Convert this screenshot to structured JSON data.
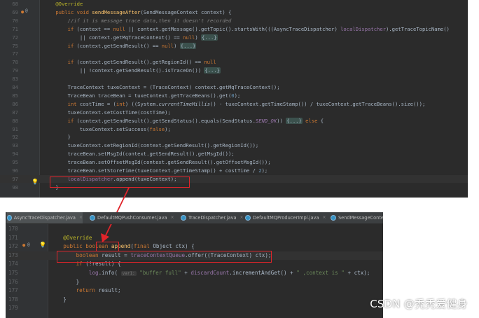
{
  "top_editor": {
    "lines": [
      {
        "n": "68",
        "html": "    <span class=\"an\">@Override</span>"
      },
      {
        "n": "69",
        "html": "    <span class=\"kw\">public void</span> <span class=\"fn\">sendMessageAfter</span>(SendMessageContext context) {"
      },
      {
        "n": "70",
        "html": "        <span class=\"cm\">//if it is message trace data,then it doesn't recorded</span>"
      },
      {
        "n": "71",
        "html": "        <span class=\"kw\">if</span> (context == <span class=\"kw\">null</span> || context.getMessage().getTopic().startsWith(((AsyncTraceDispatcher) <span class=\"fd\">localDispatcher</span>).getTraceTopicName()"
      },
      {
        "n": "72",
        "html": "            || context.getMqTraceContext() == <span class=\"kw\">null</span>) <span class=\"fold\">{...}</span>"
      },
      {
        "n": "75",
        "html": "        <span class=\"kw\">if</span> (context.getSendResult() == <span class=\"kw\">null</span>) <span class=\"fold\">{...}</span>"
      },
      {
        "n": "77",
        "html": ""
      },
      {
        "n": "78",
        "html": "        <span class=\"kw\">if</span> (context.getSendResult().getRegionId() == <span class=\"kw\">null</span>"
      },
      {
        "n": "79",
        "html": "            || !context.getSendResult().isTraceOn()) <span class=\"fold\">{...}</span>"
      },
      {
        "n": "83",
        "html": ""
      },
      {
        "n": "84",
        "html": "        TraceContext tuxeContext = (TraceContext) context.getMqTraceContext();"
      },
      {
        "n": "85",
        "html": "        TraceBean traceBean = tuxeContext.getTraceBeans().get(<span class=\"num\">0</span>);"
      },
      {
        "n": "86",
        "html": "        <span class=\"kw\">int</span> costTime = (<span class=\"kw\">int</span>) ((System.<span class=\"it\">currentTimeMillis</span>() - tuxeContext.getTimeStamp()) / tuxeContext.getTraceBeans().size());"
      },
      {
        "n": "87",
        "html": "        tuxeContext.setCostTime(costTime);"
      },
      {
        "n": "88",
        "html": "        <span class=\"kw\">if</span> (context.getSendResult().getSendStatus().equals(SendStatus.<span class=\"st-fd\">SEND_OK</span>)) <span class=\"fold\">{...}</span> <span class=\"kw\">else</span> {"
      },
      {
        "n": "91",
        "html": "            tuxeContext.setSuccess(<span class=\"kw\">false</span>);"
      },
      {
        "n": "92",
        "html": "        }"
      },
      {
        "n": "93",
        "html": "        tuxeContext.setRegionId(context.getSendResult().getRegionId());"
      },
      {
        "n": "94",
        "html": "        traceBean.setMsgId(context.getSendResult().getMsgId());"
      },
      {
        "n": "95",
        "html": "        traceBean.setOffsetMsgId(context.getSendResult().getOffsetMsgId());"
      },
      {
        "n": "96",
        "html": "        traceBean.setStoreTime(tuxeContext.getTimeStamp() + costTime / <span class=\"num\">2</span>);"
      },
      {
        "n": "97",
        "html": "        <span class=\"fd\">localDispatcher</span>.append(tuxeContext);"
      },
      {
        "n": "98",
        "html": "    }"
      }
    ]
  },
  "tabs": [
    {
      "label": "AsyncTraceDispatcher.java",
      "active": true
    },
    {
      "label": "DefaultMQPushConsumer.java",
      "active": false
    },
    {
      "label": "TraceDispatcher.java",
      "active": false
    },
    {
      "label": "DefaultMQProducerImpl.java",
      "active": false
    },
    {
      "label": "SendMessageContex",
      "active": false
    }
  ],
  "bottom_editor": {
    "lines": [
      {
        "n": "170",
        "html": ""
      },
      {
        "n": "171",
        "html": "    <span class=\"an\">@Override</span>"
      },
      {
        "n": "172",
        "html": "    <span class=\"kw\">public boolean</span> <span class=\"fn\">append</span>(<span class=\"kw\">final</span> Object ctx) {"
      },
      {
        "n": "173",
        "html": "        <span class=\"kw\">boolean</span> result = <span class=\"fd\">traceContextQueue</span>.offer((TraceContext) ctx);"
      },
      {
        "n": "174",
        "html": "        <span class=\"kw\">if</span> (!result) {"
      },
      {
        "n": "175",
        "html": "            <span class=\"fd\">log</span>.info( <span class=\"hint\">var1:</span> <span class=\"st\">\"buffer full\"</span> + <span class=\"fd\">discardCount</span>.incrementAndGet() + <span class=\"st\">\" ,context is \"</span> + ctx);"
      },
      {
        "n": "176",
        "html": "        }"
      },
      {
        "n": "177",
        "html": "        <span class=\"kw\">return</span> result;"
      },
      {
        "n": "178",
        "html": "    }"
      },
      {
        "n": "179",
        "html": ""
      }
    ]
  },
  "watermark": "CSDN @秃秃爱健身"
}
